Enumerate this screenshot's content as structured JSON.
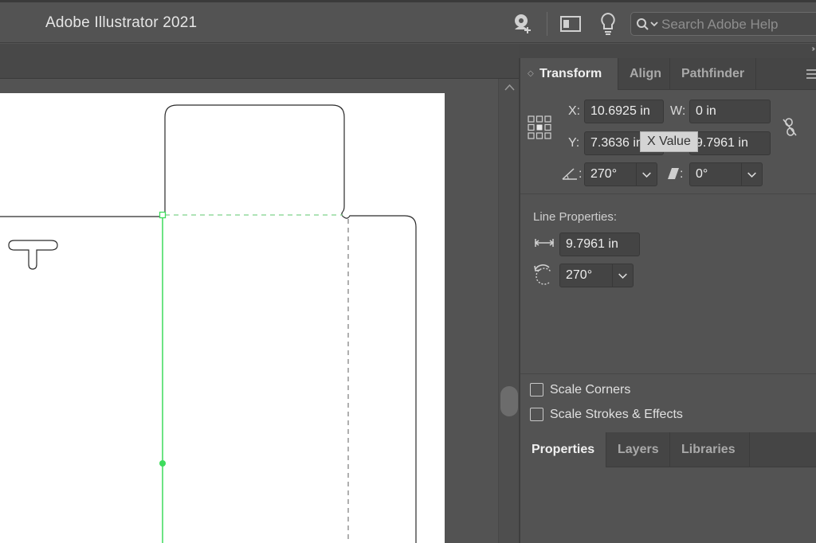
{
  "app": {
    "title": "Adobe Illustrator 2021"
  },
  "search": {
    "placeholder": "Search Adobe Help"
  },
  "transform_panel": {
    "tabs": [
      {
        "label": "Transform",
        "active": true
      },
      {
        "label": "Align",
        "active": false
      },
      {
        "label": "Pathfinder",
        "active": false
      }
    ],
    "x_label": "X:",
    "x_value": "10.6925 in",
    "y_label": "Y:",
    "y_value": "7.3636 in",
    "w_label": "W:",
    "w_value": "0 in",
    "h_value": "9.7961 in",
    "tooltip": "X Value",
    "rotate_colon": ":",
    "rotate_value": "270°",
    "shear_colon": ":",
    "shear_value": "0°",
    "line_properties_title": "Line Properties:",
    "line_length": "9.7961 in",
    "line_angle": "270°",
    "scale_corners_label": "Scale Corners",
    "scale_corners_checked": false,
    "scale_strokes_label": "Scale Strokes & Effects",
    "scale_strokes_checked": false
  },
  "properties_panel": {
    "tabs": [
      {
        "label": "Properties",
        "active": true
      },
      {
        "label": "Layers",
        "active": false
      },
      {
        "label": "Libraries",
        "active": false
      }
    ]
  },
  "colors": {
    "ui_background": "#535353",
    "selection_green": "#3ddc5c",
    "artboard": "#ffffff",
    "tooltip_bg": "#d4d4d4"
  },
  "icons": {
    "user": "user-add-icon",
    "workspace": "workspace-icon",
    "hint": "lightbulb-icon",
    "search": "search-icon",
    "reference_point": "reference-point-icon",
    "constrain": "constrain-proportions-icon",
    "rotate": "rotate-angle-icon",
    "shear": "shear-icon",
    "length": "line-length-icon",
    "line_angle": "line-angle-icon"
  }
}
